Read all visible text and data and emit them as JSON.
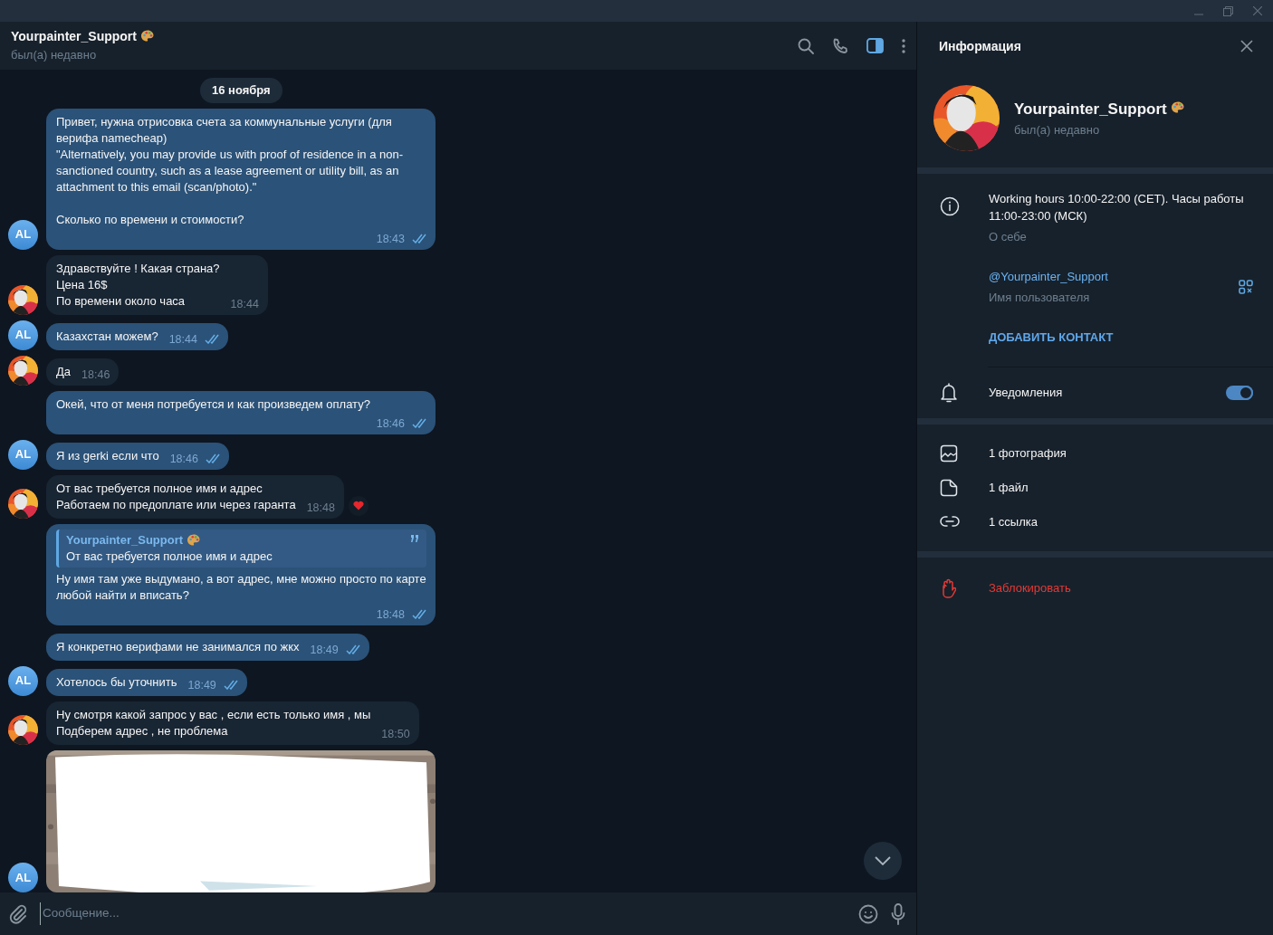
{
  "chat_header": {
    "title": "Yourpainter_Support",
    "status": "был(а) недавно",
    "sidebar_open": true
  },
  "date_badge": "16 ноября",
  "messages": [
    {
      "kind": "outgoing",
      "text": "Привет, нужна отрисовка счета за коммунальные услуги (для верифа namecheap)\n\"Alternatively, you may provide us with proof of residence in a non-sanctioned country, such as a lease agreement or utility bill, as an attachment to this email (scan/photo).\"\n\nСколько по времени и стоимости?",
      "time": "18:43",
      "read": true,
      "avatar_shown": true,
      "initials": "AL"
    },
    {
      "kind": "incoming",
      "text": "Здравствуйте ! Какая страна?\nЦена 16$\nПо времени около часа",
      "time": "18:44",
      "avatar_shown": true
    },
    {
      "kind": "outgoing",
      "text": "Казахстан можем?",
      "time": "18:44",
      "read": true,
      "avatar_shown": true,
      "initials": "AL"
    },
    {
      "kind": "incoming",
      "text": "Да",
      "time": "18:46",
      "avatar_shown": true
    },
    {
      "kind": "outgoing",
      "text": "Окей, что от меня потребуется и как произведем оплату?",
      "time": "18:46",
      "read": true,
      "avatar_shown": false
    },
    {
      "kind": "outgoing",
      "text": "Я из gerki если что",
      "time": "18:46",
      "read": true,
      "avatar_shown": true,
      "initials": "AL"
    },
    {
      "kind": "incoming",
      "text": "От вас требуется полное имя и адрес\nРаботаем по предоплате или через гаранта",
      "time": "18:48",
      "avatar_shown": true,
      "reacted": true
    },
    {
      "kind": "outgoing",
      "reply": {
        "author": "Yourpainter_Support",
        "text": "От вас требуется полное имя и адрес"
      },
      "text": "Ну имя там уже выдумано, а вот адрес, мне можно просто по карте любой найти и вписать?",
      "time": "18:48",
      "read": true,
      "avatar_shown": false
    },
    {
      "kind": "outgoing",
      "text": "Я конкретно верифами не занимался по жкх",
      "time": "18:49",
      "read": true,
      "avatar_shown": false
    },
    {
      "kind": "outgoing",
      "text": "Хотелось бы уточнить",
      "time": "18:49",
      "read": true,
      "avatar_shown": true,
      "initials": "AL"
    },
    {
      "kind": "incoming",
      "text": "Ну смотря какой запрос у вас , если есть только имя , мы\nПодберем адрес , не проблема",
      "time": "18:50",
      "avatar_shown": true
    },
    {
      "avatar_shown": true,
      "initials": "AL"
    }
  ],
  "composer": {
    "placeholder": "Сообщение..."
  },
  "info_panel": {
    "title": "Информация",
    "name": "Yourpainter_Support",
    "status": "был(а) недавно",
    "bio": "Working hours 10:00-22:00 (CET). Часы работы 11:00-23:00 (МСК)",
    "bio_label": "О себе",
    "username": "@Yourpainter_Support",
    "username_label": "Имя пользователя",
    "add_contact": "ДОБАВИТЬ КОНТАКТ",
    "notifications": {
      "label": "Уведомления",
      "on": true
    },
    "media": [
      {
        "label": "1 фотография"
      },
      {
        "kind": "file",
        "label": "1 файл"
      },
      {
        "kind": "link",
        "label": "1 ссылка"
      }
    ],
    "block": "Заблокировать"
  }
}
